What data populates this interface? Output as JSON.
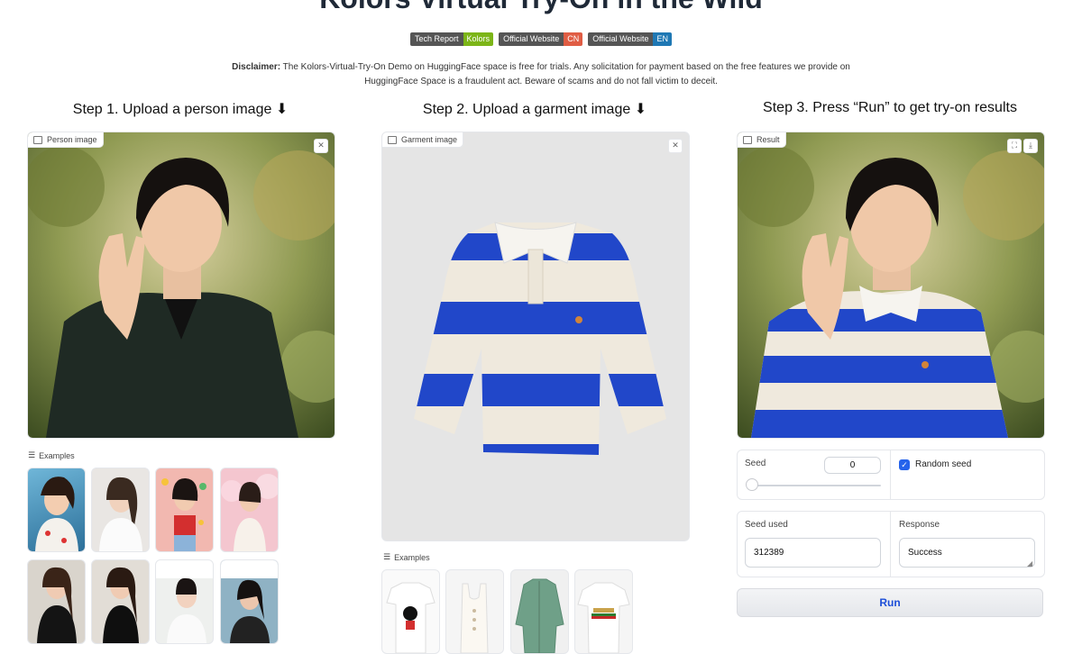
{
  "header": {
    "title": "Kolors Virtual Try-On in the Wild",
    "badges": [
      {
        "left": "Tech Report",
        "right": "Kolors",
        "color": "#7cb518"
      },
      {
        "left": "Official Website",
        "right": "CN",
        "color": "#e05d44"
      },
      {
        "left": "Official Website",
        "right": "EN",
        "color": "#1f78b4"
      }
    ],
    "disclaimer_bold": "Disclaimer:",
    "disclaimer_text": " The Kolors-Virtual-Try-On Demo on HuggingFace space is free for trials. Any solicitation for payment based on the free features we provide on HuggingFace Space is a fraudulent act. Beware of scams and do not fall victim to deceit."
  },
  "steps": {
    "step1": "Step 1. Upload a person image ⬇",
    "step2": "Step 2. Upload a garment image ⬇",
    "step3": "Step 3. Press “Run” to get try-on results"
  },
  "person_panel": {
    "label": "Person image"
  },
  "garment_panel": {
    "label": "Garment image"
  },
  "result_panel": {
    "label": "Result"
  },
  "examples": {
    "label": "Examples"
  },
  "controls": {
    "seed_label": "Seed",
    "seed_value": "0",
    "random_seed_label": "Random seed",
    "random_seed_checked": true,
    "seed_used_label": "Seed used",
    "seed_used_value": "312389",
    "response_label": "Response",
    "response_value": "Success",
    "run_label": "Run"
  },
  "colors": {
    "accent": "#1d4ed8",
    "checkbox": "#2563eb",
    "stripe_blue": "#2147c9",
    "cream": "#efe9dd"
  }
}
